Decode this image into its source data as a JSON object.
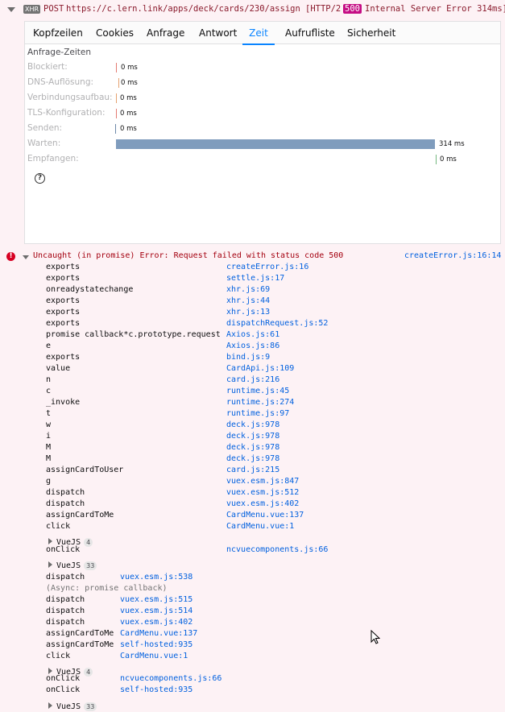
{
  "request": {
    "badge": "XHR",
    "method": "POST",
    "url": "https://c.lern.link/apps/deck/cards/230/assign",
    "protocol": "[HTTP/2",
    "status_code": "500",
    "status_rest": "Internal Server Error 314ms]"
  },
  "tabs": [
    "Kopfzeilen",
    "Cookies",
    "Anfrage",
    "Antwort",
    "Zeit",
    "Aufrufliste",
    "Sicherheit"
  ],
  "active_tab": "Zeit",
  "timing": {
    "title": "Anfrage-Zeiten",
    "rows": [
      {
        "label": "Blockiert:",
        "value": "0 ms",
        "color": "#e47a72"
      },
      {
        "label": "DNS-Auflösung:",
        "value": "0 ms",
        "color": "#e5a16f"
      },
      {
        "label": "Verbindungsaufbau:",
        "value": "0 ms",
        "color": "#e5a16f"
      },
      {
        "label": "TLS-Konfiguration:",
        "value": "0 ms",
        "color": "#e47a72"
      },
      {
        "label": "Senden:",
        "value": "0 ms",
        "color": "#6d88a8"
      },
      {
        "label": "Warten:",
        "value": "314 ms",
        "color": "#7f9cbd"
      },
      {
        "label": "Empfangen:",
        "value": "0 ms",
        "color": "#74b77f"
      }
    ],
    "help_icon": "question-icon"
  },
  "console": {
    "error_message": "Uncaught (in promise) Error: Request failed with status code 500",
    "error_location": "createError.js:16:14",
    "stack1": [
      [
        "exports",
        "createError.js:16"
      ],
      [
        "exports",
        "settle.js:17"
      ],
      [
        "onreadystatechange",
        "xhr.js:69"
      ],
      [
        "exports",
        "xhr.js:44"
      ],
      [
        "exports",
        "xhr.js:13"
      ],
      [
        "exports",
        "dispatchRequest.js:52"
      ],
      [
        "promise callback*c.prototype.request",
        "Axios.js:61"
      ],
      [
        "e",
        "Axios.js:86"
      ],
      [
        "exports",
        "bind.js:9"
      ],
      [
        "value",
        "CardApi.js:109"
      ],
      [
        "n",
        "card.js:216"
      ],
      [
        "c",
        "runtime.js:45"
      ],
      [
        "_invoke",
        "runtime.js:274"
      ],
      [
        "t",
        "runtime.js:97"
      ],
      [
        "w",
        "deck.js:978"
      ],
      [
        "i",
        "deck.js:978"
      ],
      [
        "M",
        "deck.js:978"
      ],
      [
        "M",
        "deck.js:978"
      ],
      [
        "assignCardToUser",
        "card.js:215"
      ],
      [
        "g",
        "vuex.esm.js:847"
      ],
      [
        "dispatch",
        "vuex.esm.js:512"
      ],
      [
        "dispatch",
        "vuex.esm.js:402"
      ],
      [
        "assignCardToMe",
        "CardMenu.vue:137"
      ],
      [
        "click",
        "CardMenu.vue:1"
      ]
    ],
    "group1": {
      "name": "VueJS",
      "count": "4"
    },
    "onclick1": [
      "onClick",
      "ncvuecomponents.js:66"
    ],
    "group2": {
      "name": "VueJS",
      "count": "33"
    },
    "stack2": [
      [
        "dispatch",
        "vuex.esm.js:538"
      ],
      [
        "(Async: promise callback)",
        ""
      ],
      [
        "dispatch",
        "vuex.esm.js:515"
      ],
      [
        "dispatch",
        "vuex.esm.js:514"
      ],
      [
        "dispatch",
        "vuex.esm.js:402"
      ],
      [
        "assignCardToMe",
        "CardMenu.vue:137"
      ],
      [
        "assignCardToMe",
        "self-hosted:935"
      ],
      [
        "click",
        "CardMenu.vue:1"
      ]
    ],
    "group3": {
      "name": "VueJS",
      "count": "4"
    },
    "stack3": [
      [
        "onClick",
        "ncvuecomponents.js:66"
      ],
      [
        "onClick",
        "self-hosted:935"
      ]
    ],
    "group4": {
      "name": "VueJS",
      "count": "33"
    }
  }
}
